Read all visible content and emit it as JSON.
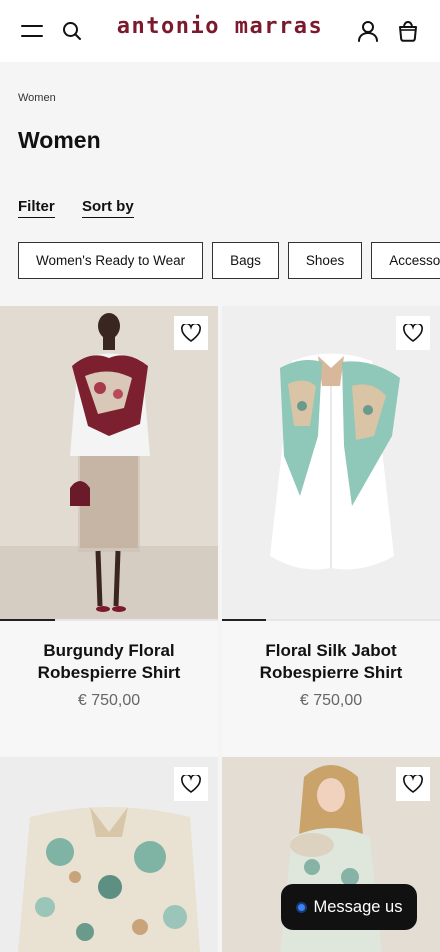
{
  "header": {
    "logo": "antonio marras",
    "menu_icon": "hamburger-menu-icon",
    "search_icon": "search-icon",
    "account_icon": "user-icon",
    "bag_icon": "shopping-bag-icon",
    "logo_color": "#7a1a2c"
  },
  "breadcrumb": "Women",
  "page_title": "Women",
  "toolbar": {
    "filter_label": "Filter",
    "sort_label": "Sort by"
  },
  "categories": [
    "Women's Ready to Wear",
    "Bags",
    "Shoes",
    "Accessories"
  ],
  "products": [
    {
      "name_line1": "Burgundy Floral",
      "name_line2": "Robespierre Shirt",
      "price": "€ 750,00",
      "gallery_progress": 0.25
    },
    {
      "name_line1": "Floral Silk Jabot",
      "name_line2": "Robespierre Shirt",
      "price": "€ 750,00",
      "gallery_progress": 0.2
    },
    {
      "name_line1": "",
      "name_line2": "",
      "price": ""
    },
    {
      "name_line1": "",
      "name_line2": "",
      "price": ""
    }
  ],
  "chat": {
    "label": "Message us"
  }
}
